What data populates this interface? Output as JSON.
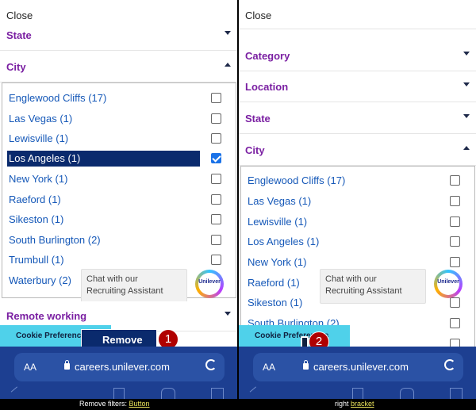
{
  "left_panel": {
    "close": "Close",
    "state": "State",
    "city": "City",
    "cities": [
      {
        "label": "Englewood Cliffs (17)",
        "checked": false
      },
      {
        "label": "Las Vegas (1)",
        "checked": false
      },
      {
        "label": "Lewisville (1)",
        "checked": false
      },
      {
        "label": "Los Angeles (1)",
        "checked": true
      },
      {
        "label": "New York (1)",
        "checked": false
      },
      {
        "label": "Raeford (1)",
        "checked": false
      },
      {
        "label": "Sikeston (1)",
        "checked": false
      },
      {
        "label": "South Burlington (2)",
        "checked": false
      },
      {
        "label": "Trumbull (1)",
        "checked": false
      },
      {
        "label": "Waterbury (2)",
        "checked": false
      }
    ],
    "remote": "Remote working",
    "chat_line1": "Chat with our",
    "chat_line2": "Recruiting Assistant",
    "chat_logo": "Unilever",
    "cookie": "Cookie Preferences",
    "apply": "Remove filters",
    "badge": "1",
    "aa": "AA",
    "url": "careers.unilever.com"
  },
  "right_panel": {
    "close": "Close",
    "category": "Category",
    "location": "Location",
    "state": "State",
    "city": "City",
    "cities": [
      {
        "label": "Englewood Cliffs (17)"
      },
      {
        "label": "Las Vegas (1)"
      },
      {
        "label": "Lewisville (1)"
      },
      {
        "label": "Los Angeles (1)"
      },
      {
        "label": "New York (1)"
      },
      {
        "label": "Raeford (1)"
      },
      {
        "label": "Sikeston (1)"
      },
      {
        "label": "South Burlington (2)"
      }
    ],
    "chat_line1": "Chat with our",
    "chat_line2": "Recruiting Assistant",
    "chat_logo": "Unilever",
    "cookie": "Cookie Preferences",
    "badge": "2",
    "aa": "AA",
    "url": "careers.unilever.com"
  },
  "captions": {
    "left_prefix": "Remove filters:",
    "left_role": "Button",
    "right_prefix": "right",
    "right_role": "bracket"
  }
}
